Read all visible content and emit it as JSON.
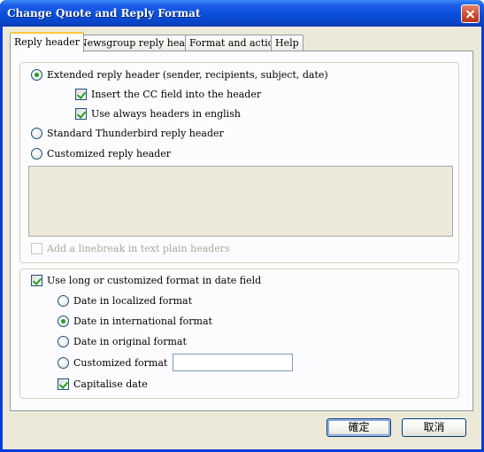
{
  "window": {
    "title": "Change Quote and Reply Format"
  },
  "tabs": [
    {
      "label": "Reply header",
      "active": true
    },
    {
      "label": "Newsgroup reply headers",
      "active": false
    },
    {
      "label": "Format and actions",
      "active": false
    },
    {
      "label": "Help",
      "active": false
    }
  ],
  "reply_header_group": {
    "extended_radio": {
      "label": "Extended reply header (sender, recipients, subject, date)",
      "selected": true
    },
    "insert_cc_check": {
      "label": "Insert the CC field into the header",
      "checked": true
    },
    "english_headers_check": {
      "label": "Use always headers in english",
      "checked": true
    },
    "standard_radio": {
      "label": "Standard Thunderbird reply header",
      "selected": false
    },
    "customized_radio": {
      "label": "Customized reply header",
      "selected": false
    },
    "custom_header_text": "",
    "linebreak_check": {
      "label": "Add a linebreak in text plain headers",
      "checked": false,
      "disabled": true
    }
  },
  "date_group": {
    "long_format_check": {
      "label": "Use long or customized format in date field",
      "checked": true
    },
    "localized_radio": {
      "label": "Date in localized format",
      "selected": false
    },
    "international_radio": {
      "label": "Date in international format",
      "selected": true
    },
    "original_radio": {
      "label": "Date in original format",
      "selected": false
    },
    "customized_radio": {
      "label": "Customized format",
      "selected": false
    },
    "customized_value": "",
    "capitalise_check": {
      "label": "Capitalise date",
      "checked": true
    }
  },
  "buttons": {
    "ok": "確定",
    "cancel": "取消"
  },
  "colors": {
    "titlebar": "#0b4ed9",
    "dialog_bg": "#ece9d8",
    "tab_highlight": "#ffc83c",
    "check_mark": "#21a121"
  }
}
